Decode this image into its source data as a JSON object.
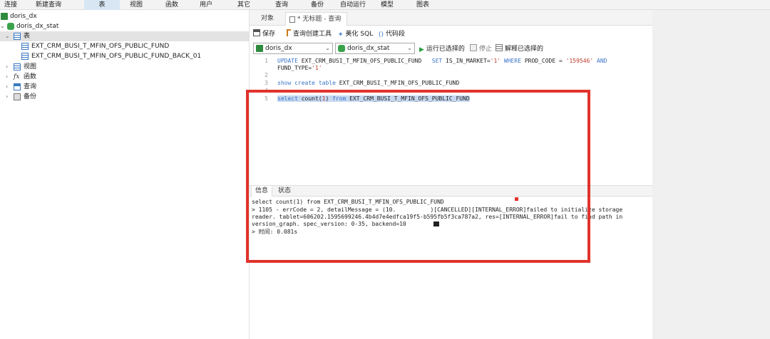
{
  "menubar": {
    "items": [
      "连接",
      "新建查询",
      "表",
      "视图",
      "函数",
      "用户",
      "其它",
      "查询",
      "备份",
      "自动运行",
      "模型",
      "图表"
    ],
    "active_index": 2
  },
  "tree": {
    "connection": "doris_dx",
    "database": "doris_dx_stat",
    "tables_label": "表",
    "tables": [
      "EXT_CRM_BUSI_T_MFIN_OFS_PUBLIC_FUND",
      "EXT_CRM_BUSI_T_MFIN_OFS_PUBLIC_FUND_BACK_01"
    ],
    "views_label": "视图",
    "functions_label": "函数",
    "functions_icon_text": "fx",
    "queries_label": "查询",
    "backups_label": "备份"
  },
  "tabs": {
    "objects": "对象",
    "query": "* 无标题 - 查询"
  },
  "toolbar": {
    "save": "保存",
    "query_builder": "查询创建工具",
    "beautify": "美化 SQL",
    "code_snippet": "代码段",
    "run_selected": "运行已选择的",
    "stop": "停止",
    "explain_selected": "解释已选择的"
  },
  "selects": {
    "connection": "doris_dx",
    "database": "doris_dx_stat"
  },
  "editor": {
    "line_numbers": [
      "1",
      "2",
      "3",
      "4",
      "5"
    ],
    "l1_kw1": "UPDATE",
    "l1_t1": " EXT_CRM_BUSI_T_MFIN_OFS_PUBLIC_FUND   ",
    "l1_kw2": "SET",
    "l1_t2": " IS_IN_MARKET=",
    "l1_s1": "'1'",
    "l1_t3": " ",
    "l1_kw3": "WHERE",
    "l1_t4": " PROD_CODE = ",
    "l1_s2": "'159546'",
    "l1_t5": " ",
    "l1_kw4": "AND",
    "l1b_t": "FUND_TYPE=",
    "l1b_s": "'1'",
    "l3_kw1": "show",
    "l3_t1": " ",
    "l3_kw2": "create",
    "l3_t2": " ",
    "l3_kw3": "table",
    "l3_t3": " EXT_CRM_BUSI_T_MFIN_OFS_PUBLIC_FUND",
    "l5_kw1": "select",
    "l5_t1": " count(",
    "l5_n": "1",
    "l5_t2": ") ",
    "l5_kw2": "from",
    "l5_t3": " EXT_CRM_BUSI_T_MFIN_OFS_PUBLIC_FUND"
  },
  "messages": {
    "tab_info": "信息",
    "tab_status": "状态",
    "line1": "select count(1) from EXT_CRM_BUSI_T_MFIN_OFS_PUBLIC_FUND",
    "line2": "> 1105 - errCode = 2, detailMessage = (10.          )[CANCELLED][INTERNAL_ERROR]failed to initialize storage",
    "line3": "reader. tablet=606202.1595699246.4b4d7e4edfca19f5-b595fb5f3ca787a2, res=[INTERNAL_ERROR]fail to find path in",
    "line4": "version_graph. spec_version: 0-35, backend=10",
    "line5": "> 时间: 0.081s"
  },
  "colors": {
    "highlight_box": "#e0332c",
    "keyword": "#3b74c9",
    "string": "#c0392b",
    "selection": "#c7d9f1"
  }
}
